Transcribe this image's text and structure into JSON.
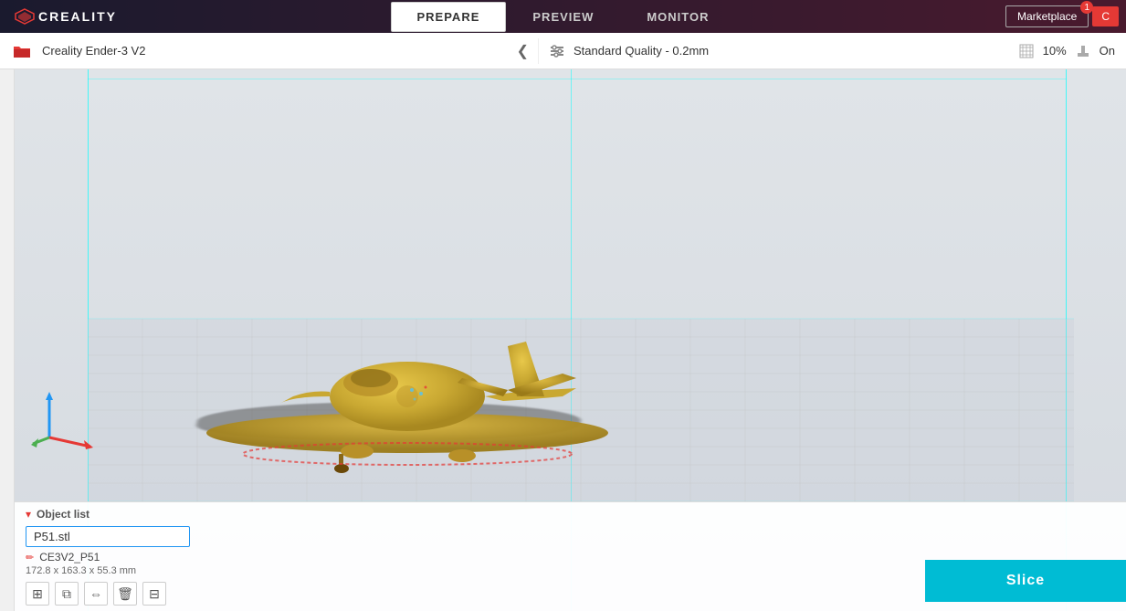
{
  "app": {
    "logo": "CREALITY",
    "logo_symbol": "⬡"
  },
  "nav": {
    "tabs": [
      {
        "id": "prepare",
        "label": "PREPARE",
        "active": true
      },
      {
        "id": "preview",
        "label": "PREVIEW",
        "active": false
      },
      {
        "id": "monitor",
        "label": "MONITOR",
        "active": false
      }
    ],
    "marketplace_label": "Marketplace",
    "marketplace_badge": "1",
    "user_button": "C"
  },
  "toolbar": {
    "printer_name": "Creality Ender-3 V2",
    "quality_label": "Standard Quality - 0.2mm",
    "infill_percent": "10%",
    "support_label": "On"
  },
  "viewport": {
    "object_list_label": "Object list",
    "object_filename": "P51.stl",
    "object_config": "CE3V2_P51",
    "dimensions": "172.8 x 163.3 x 55.3 mm"
  },
  "actions": {
    "slice_label": "Slice"
  },
  "colors": {
    "accent": "#e53935",
    "cyan": "#00BCD4",
    "nav_bg": "#2d1a2e"
  }
}
